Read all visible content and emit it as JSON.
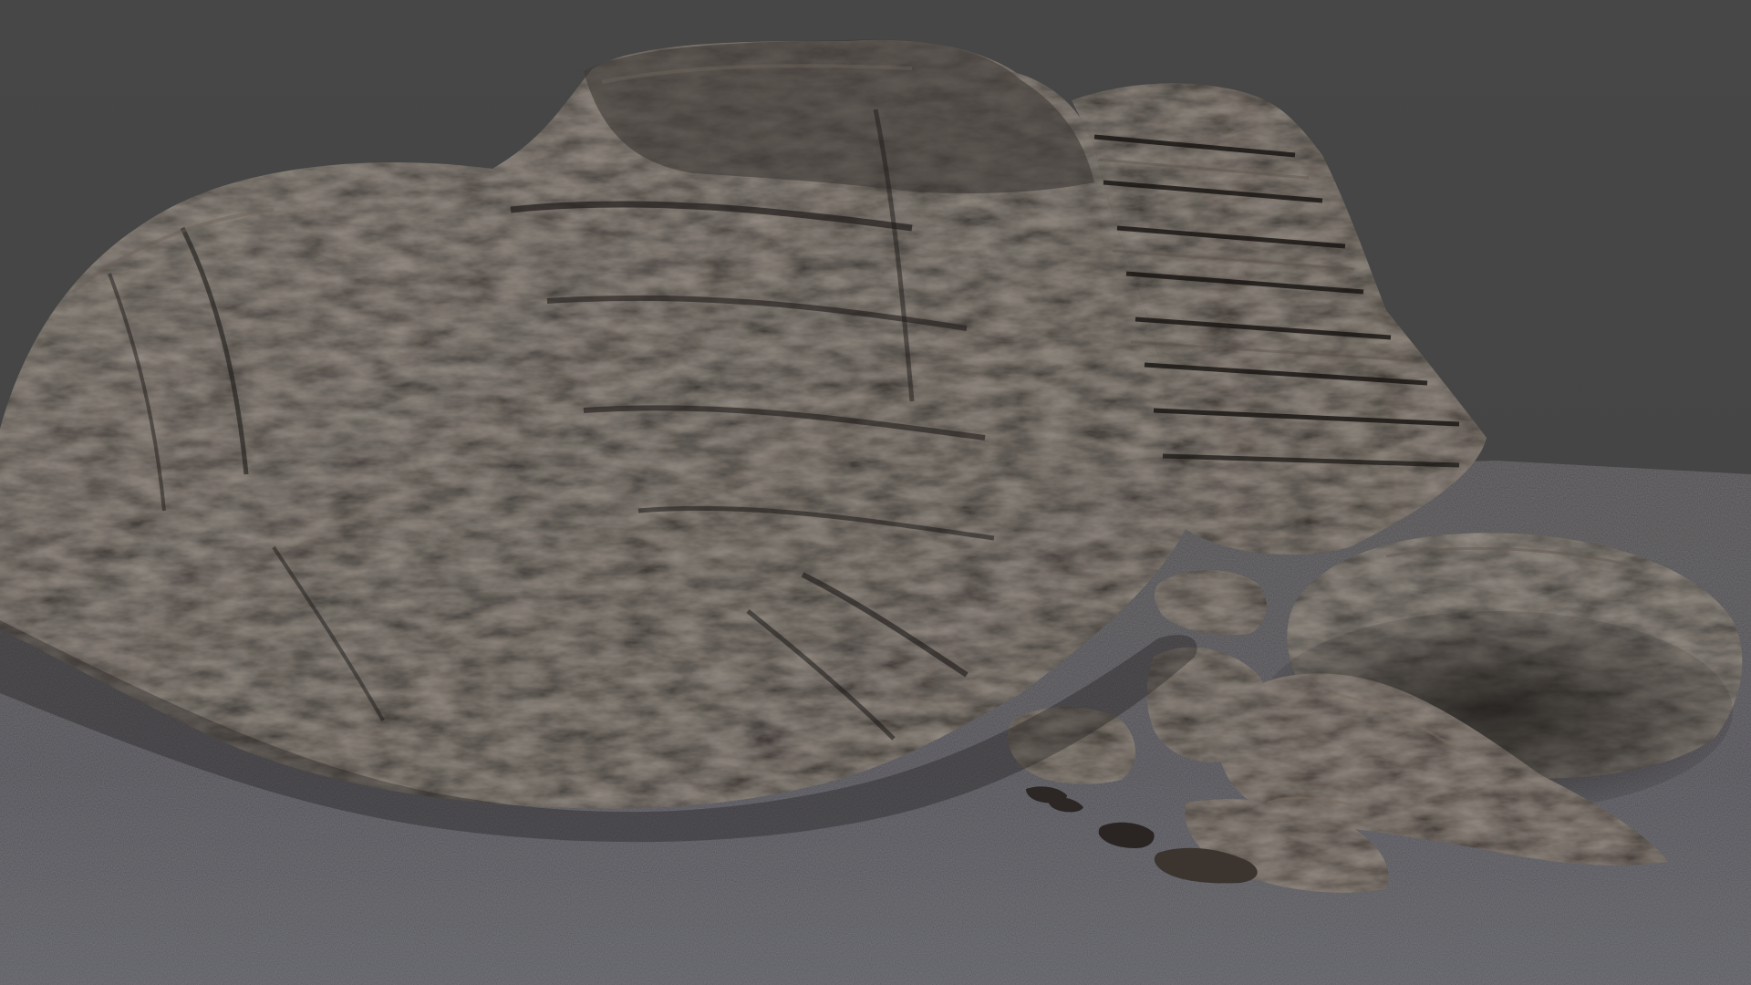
{
  "scene": {
    "subject": "rock-formation-render",
    "background_color": "#454545",
    "ground_color": "#4a4a4c",
    "rock_color": "#3a3633",
    "rock_highlight_color": "#6d6257",
    "rock_shadow_color": "#1f1c1a",
    "text": []
  }
}
